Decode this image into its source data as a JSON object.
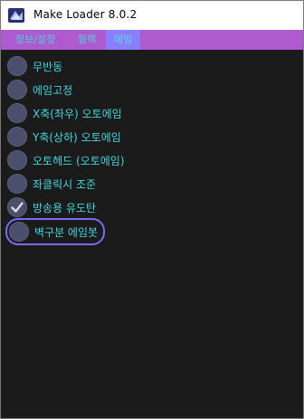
{
  "window": {
    "title": "Make Loader 8.0.2",
    "icon": "app-logo-icon"
  },
  "tabs": [
    {
      "label": "정보/설정",
      "active": false
    },
    {
      "label": "월핵",
      "active": false
    },
    {
      "label": "에임",
      "active": true
    }
  ],
  "options": [
    {
      "label": "무반동",
      "checked": false
    },
    {
      "label": "에임고정",
      "checked": false
    },
    {
      "label": "X축(좌우) 오토에임",
      "checked": false
    },
    {
      "label": "Y축(상하) 오토에임",
      "checked": false
    },
    {
      "label": "오토헤드 (오토에임)",
      "checked": false
    },
    {
      "label": "좌클릭시 조준",
      "checked": false
    },
    {
      "label": "방송용 유도탄",
      "checked": true
    },
    {
      "label": "벽구분 에임봇",
      "checked": false,
      "highlighted": true
    }
  ],
  "colors": {
    "tabbar": "#b05ad0",
    "active_tab": "#8b7fff",
    "text": "#43d6dc",
    "background": "#1b1b1b",
    "radio": "#4b4f6b",
    "focus_ring": "#7c69ff"
  }
}
